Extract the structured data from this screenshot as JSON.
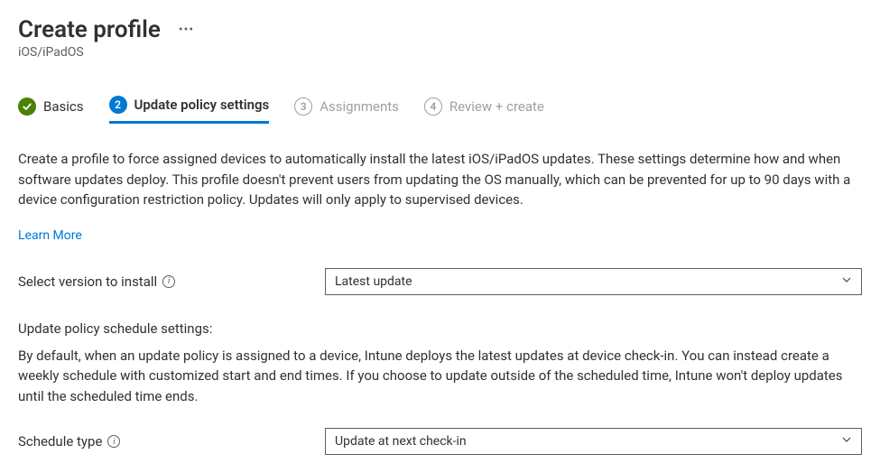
{
  "header": {
    "title": "Create profile",
    "subtitle": "iOS/iPadOS"
  },
  "steps": {
    "basics": "Basics",
    "update_settings_num": "2",
    "update_settings": "Update policy settings",
    "assignments_num": "3",
    "assignments": "Assignments",
    "review_num": "4",
    "review": "Review + create"
  },
  "main": {
    "description": "Create a profile to force assigned devices to automatically install the latest iOS/iPadOS updates. These settings determine how and when software updates deploy. This profile doesn't prevent users from updating the OS manually, which can be prevented for up to 90 days with a device configuration restriction policy. Updates will only apply to supervised devices.",
    "learn_more": "Learn More"
  },
  "form": {
    "version_label": "Select version to install",
    "version_value": "Latest update",
    "schedule_heading": "Update policy schedule settings:",
    "schedule_description": "By default, when an update policy is assigned to a device, Intune deploys the latest updates at device check-in. You can instead create a weekly schedule with customized start and end times. If you choose to update outside of the scheduled time, Intune won't deploy updates until the scheduled time ends.",
    "schedule_type_label": "Schedule type",
    "schedule_type_value": "Update at next check-in"
  }
}
